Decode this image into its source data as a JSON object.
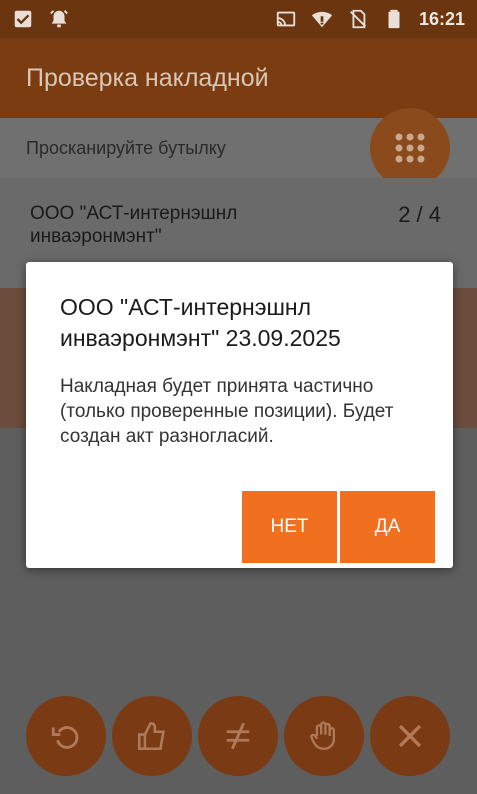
{
  "status_bar": {
    "time": "16:21",
    "left_icons": [
      "checkbox-icon",
      "alarm-icon"
    ],
    "right_icons": [
      "cast-icon",
      "wifi-icon",
      "no-sim-icon",
      "battery-icon"
    ]
  },
  "app_bar": {
    "title": "Проверка накладной"
  },
  "screen": {
    "scan_hint": "Просканируйте бутылку",
    "list_item": {
      "name": "ООО \"АСТ-интернэшнл инваэронмэнт\"",
      "count": "2 / 4"
    },
    "fab_icons": [
      "undo-icon",
      "thumbs-up-icon",
      "not-equal-icon",
      "hand-stop-icon",
      "close-icon"
    ]
  },
  "dialog": {
    "title": "ООО \"АСТ-интернэшнл инваэронмэнт\" 23.09.2025",
    "message": "Накладная будет принята частично (только проверенные позиции). Будет создан акт разногласий.",
    "no_label": "НЕТ",
    "yes_label": "ДА"
  },
  "colors": {
    "accent": "#f07020",
    "app_bar": "#7a3c10"
  }
}
